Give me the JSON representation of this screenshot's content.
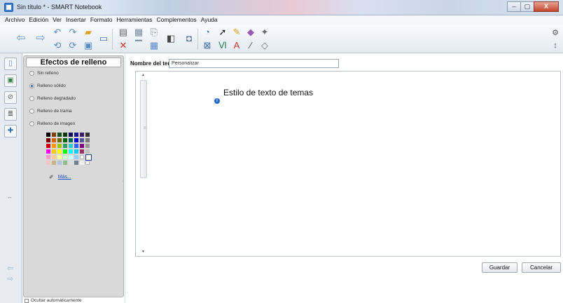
{
  "window": {
    "title": "Sin título * - SMART Notebook",
    "buttons": {
      "minimize": "–",
      "maximize": "▢",
      "close": "X"
    }
  },
  "menu": [
    "Archivo",
    "Edición",
    "Ver",
    "Insertar",
    "Formato",
    "Herramientas",
    "Complementos",
    "Ayuda"
  ],
  "toolbar": {
    "icons": [
      "back-arrow-icon",
      "forward-arrow-icon",
      "undo-icon",
      "redo-icon",
      "open-folder-icon",
      "screen-capture-icon",
      "delete-icon",
      "save-icon",
      "new-page-icon",
      "table-icon",
      "paste-icon",
      "projector-icon",
      "camera-icon",
      "select-arrow-icon",
      "pen-icon",
      "eraser-icon",
      "magic-pen-icon",
      "shape-icon",
      "line-icon",
      "text-icon",
      "fill-icon",
      "settings-gear-icon",
      "expand-icon"
    ],
    "accent": "#6b9bd6"
  },
  "sidebar": {
    "tabs": [
      "page-sorter-icon",
      "gallery-icon",
      "attachments-icon",
      "properties-icon",
      "addons-icon"
    ],
    "collapse_arrows": "↔",
    "nav": [
      "⇦",
      "⇨"
    ]
  },
  "fill_panel": {
    "title": "Efectos de relleno",
    "options": [
      {
        "label": "Sin relleno",
        "selected": false
      },
      {
        "label": "Relleno sólido",
        "selected": true
      },
      {
        "label": "Relleno degradado",
        "selected": false
      },
      {
        "label": "Relleno de trama",
        "selected": false
      },
      {
        "label": "Relleno de imagen",
        "selected": false
      }
    ],
    "palette_rows": [
      [
        "#000000",
        "#7f3f00",
        "#1d4f1d",
        "#0e3a0e",
        "#10105a",
        "#1a1a8a",
        "#3a1a6a",
        "#333333"
      ],
      [
        "#7f0000",
        "#cc6600",
        "#6b6b00",
        "#006600",
        "#006666",
        "#0000cc",
        "#555599",
        "#777777"
      ],
      [
        "#cc0000",
        "#ff9900",
        "#99cc00",
        "#339966",
        "#33cccc",
        "#3366ff",
        "#800080",
        "#999999"
      ],
      [
        "#ff00ff",
        "#ffcc00",
        "#ffff00",
        "#00ff00",
        "#00ffff",
        "#00ccff",
        "#993366",
        "#c0c0c0"
      ],
      [
        "#ff99cc",
        "#ffcc99",
        "#ffff99",
        "#ccffcc",
        "#ccffff",
        "#99ccff",
        "#ffffff",
        "#ffffff"
      ],
      [
        "#f3c6c6",
        "#c9b38a",
        "#b0c4de",
        "#8fbc8f",
        "#dcdcdc",
        "#708090",
        "#f0f0f0",
        "#ffffff"
      ]
    ],
    "more_label": "Más...",
    "autohide_label": "Ocultar automáticamente"
  },
  "theme": {
    "name_label": "Nombre del tema:",
    "name_value": "Personalizar",
    "canvas_text": "Estilo de texto de temas",
    "info_glyph": "i"
  },
  "actions": {
    "save": "Guardar",
    "cancel": "Cancelar"
  }
}
